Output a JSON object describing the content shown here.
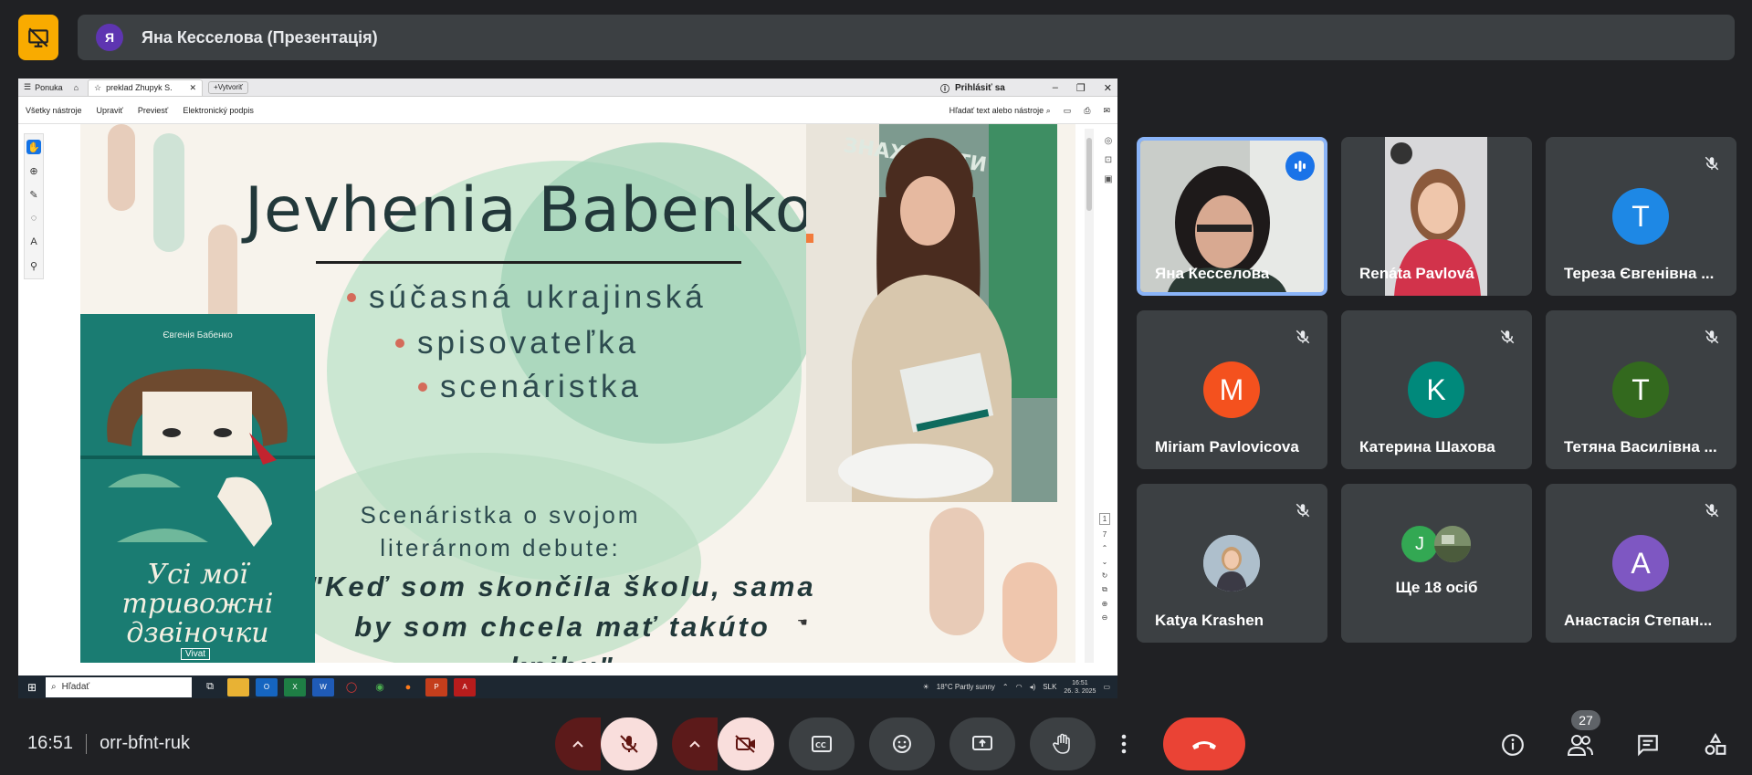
{
  "presenter": {
    "avatar_letter": "Я",
    "title": "Яна Кесселова (Презентація)"
  },
  "viewer": {
    "menu_label": "Ponuka",
    "tab_label": "preklad Zhupyk S.",
    "new_tab_label": "Vytvoriť",
    "signin_label": "Prihlásiť sa",
    "toolbar": {
      "all_tools": "Všetky nástroje",
      "edit": "Upraviť",
      "convert": "Previesť",
      "esign": "Elektronický podpis",
      "search_placeholder": "Hľadať text alebo nástroje"
    },
    "page_current": "1",
    "page_total": "7"
  },
  "slide": {
    "title": "Jevhenia Babenko",
    "bullets": [
      "súčasná ukrajinská",
      "spisovateľka",
      "scenáristka"
    ],
    "quote_intro": "Scenáristka  o svojom literárnom debute:",
    "quote": "\"Keď som skončila školu, sama by som chcela mať takúto knihu\"",
    "book": {
      "author": "Євгенія Бабенко",
      "title": "Усі мої тривожні дзвіночки",
      "publisher": "Vivat"
    },
    "photo_sign": "ЗНАХОДИТИ"
  },
  "taskbar": {
    "search_placeholder": "Hľadať",
    "weather": "18°C  Partly sunny",
    "lang": "SLK",
    "time": "16:51",
    "date": "26. 3. 2025"
  },
  "participants": [
    {
      "name": "Яна Кесселова",
      "speaking": true
    },
    {
      "name": "Renáta Pavlová"
    },
    {
      "name": "Тереза Євгенівна ...",
      "letter": "T",
      "color": "#1e88e5"
    },
    {
      "name": "Miriam Pavlovicova",
      "letter": "M",
      "color": "#f4511e"
    },
    {
      "name": "Катерина Шахова",
      "letter": "K",
      "color": "#00897b"
    },
    {
      "name": "Тетяна Василівна ...",
      "letter": "T",
      "color": "#33691e"
    },
    {
      "name": "Katya Krashen"
    },
    {
      "name": "Ще 18 осіб",
      "mini_letter": "J"
    },
    {
      "name": "Анастасія Степан...",
      "letter": "A",
      "color": "#7e57c2"
    }
  ],
  "meeting": {
    "time": "16:51",
    "code": "orr-bfnt-ruk",
    "participant_count": "27"
  },
  "colors": {
    "background": "#202124",
    "tile": "#3c4043",
    "hangup": "#ea4335",
    "muted": "#f9dedc"
  }
}
